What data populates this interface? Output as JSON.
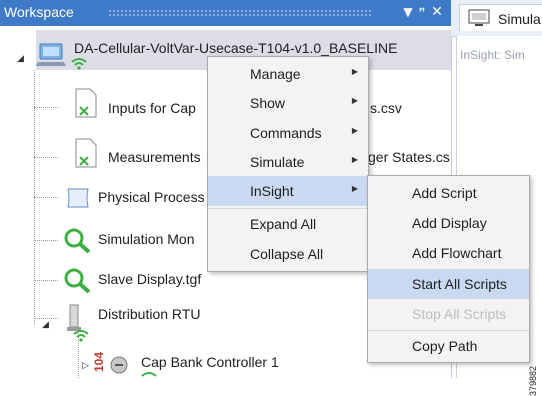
{
  "workspace": {
    "title": "Workspace",
    "pin_glyph": "▾ ꜗ",
    "close_glyph": "✕"
  },
  "tree": {
    "root": "DA-Cellular-VoltVar-Usecase-T104-v1.0_BASELINE",
    "items": [
      {
        "label": "Inputs for Cap",
        "suffix": "s.csv"
      },
      {
        "label": "Measurements",
        "suffix": "ger States.cs"
      },
      {
        "label": "Physical Process",
        "suffix": ""
      },
      {
        "label": "Simulation Mon",
        "suffix": ""
      },
      {
        "label": "Slave Display.tgf",
        "suffix": ""
      },
      {
        "label": "Distribution RTU",
        "suffix": ""
      },
      {
        "label": "Cap Bank Controller 1",
        "suffix": ""
      }
    ],
    "device_id": "104"
  },
  "simulation": {
    "tab_label": "Simula",
    "sub_label": "InSight: Sim"
  },
  "context_menu": {
    "items": [
      {
        "label": "Manage"
      },
      {
        "label": "Show"
      },
      {
        "label": "Commands"
      },
      {
        "label": "Simulate"
      },
      {
        "label": "InSight"
      },
      {
        "label": "Expand All"
      },
      {
        "label": "Collapse All"
      }
    ]
  },
  "insight_menu": {
    "items": [
      {
        "label": "Add Script"
      },
      {
        "label": "Add Display"
      },
      {
        "label": "Add Flowchart"
      },
      {
        "label": "Start All Scripts"
      },
      {
        "label": "Stop All Scripts"
      },
      {
        "label": "Copy Path"
      }
    ]
  },
  "figure_number": "379882",
  "colors": {
    "header_blue": "#3f7ac9",
    "menu_highlight": "#c9d9f1",
    "selection": "#dcdde7",
    "wifi_green": "#3cb043",
    "device_red": "#c0392b"
  }
}
